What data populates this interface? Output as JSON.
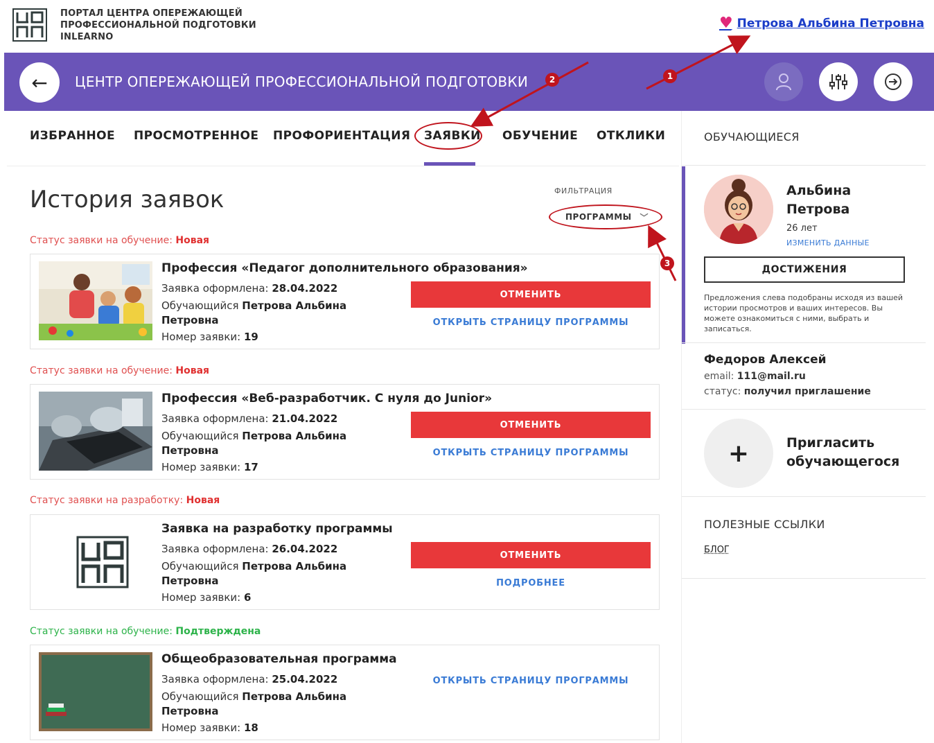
{
  "portal": {
    "name_line1": "ПОРТАЛ ЦЕНТРА ОПЕРЕЖАЮЩЕЙ",
    "name_line2": "ПРОФЕССИОНАЛЬНОЙ ПОДГОТОВКИ",
    "name_line3": "INLEARNO",
    "user_link": "Петрова Альбина Петровна"
  },
  "header": {
    "title": "ЦЕНТР ОПЕРЕЖАЮЩЕЙ ПРОФЕССИОНАЛЬНОЙ ПОДГОТОВКИ"
  },
  "tabs": [
    {
      "label": "ИЗБРАННОЕ"
    },
    {
      "label": "ПРОСМОТРЕННОЕ"
    },
    {
      "label": "ПРОФОРИЕНТАЦИЯ"
    },
    {
      "label": "ЗАЯВКИ",
      "active": true
    },
    {
      "label": "ОБУЧЕНИЕ"
    },
    {
      "label": "ОТКЛИКИ"
    }
  ],
  "main": {
    "title": "История заявок",
    "filter_label": "ФИЛЬТРАЦИЯ",
    "filter_value": "ПРОГРАММЫ"
  },
  "applications": [
    {
      "status_prefix": "Статус заявки на обучение:",
      "status_value": "Новая",
      "title": "Профессия «Педагог дополнительного образования»",
      "date_label": "Заявка оформлена:",
      "date": "28.04.2022",
      "student_label": "Обучающийся",
      "student_line1": "Петрова Альбина",
      "student_line2": "Петровна",
      "number_label": "Номер заявки:",
      "number": "19",
      "cancel_label": "ОТМЕНИТЬ",
      "link_label": "ОТКРЫТЬ СТРАНИЦУ ПРОГРАММЫ"
    },
    {
      "status_prefix": "Статус заявки на обучение:",
      "status_value": "Новая",
      "title": "Профессия «Веб-разработчик. С нуля до Junior»",
      "date_label": "Заявка оформлена:",
      "date": "21.04.2022",
      "student_label": "Обучающийся",
      "student_line1": "Петрова Альбина",
      "student_line2": "Петровна",
      "number_label": "Номер заявки:",
      "number": "17",
      "cancel_label": "ОТМЕНИТЬ",
      "link_label": "ОТКРЫТЬ СТРАНИЦУ ПРОГРАММЫ"
    },
    {
      "status_prefix": "Статус заявки на разработку:",
      "status_value": "Новая",
      "title": "Заявка на разработку программы",
      "date_label": "Заявка оформлена:",
      "date": "26.04.2022",
      "student_label": "Обучающийся",
      "student_line1": "Петрова Альбина",
      "student_line2": "Петровна",
      "number_label": "Номер заявки:",
      "number": "6",
      "cancel_label": "ОТМЕНИТЬ",
      "link_label": "ПОДРОБНЕЕ"
    },
    {
      "status_prefix": "Статус заявки на обучение:",
      "status_value": "Подтверждена",
      "title": "Общеобразовательная программа",
      "date_label": "Заявка оформлена:",
      "date": "25.04.2022",
      "student_label": "Обучающийся",
      "student_line1": "Петрова Альбина",
      "student_line2": "Петровна",
      "number_label": "Номер заявки:",
      "number": "18",
      "link_label": "ОТКРЫТЬ СТРАНИЦУ ПРОГРАММЫ"
    }
  ],
  "sidebar": {
    "students_heading": "ОБУЧАЮЩИЕСЯ",
    "profile_first": "Альбина",
    "profile_last": "Петрова",
    "profile_age": "26 лет",
    "edit_link": "ИЗМЕНИТЬ ДАННЫЕ",
    "achievements_label": "ДОСТИЖЕНИЯ",
    "note": "Предложения слева подобраны исходя из вашей истории просмотров и ваших интересов. Вы можете ознакомиться с ними, выбрать и записаться.",
    "student2_name": "Федоров Алексей",
    "student2_email_label": "email:",
    "student2_email": "111@mail.ru",
    "student2_status_label": "статус:",
    "student2_status": "получил приглашение",
    "invite_line1": "Пригласить",
    "invite_line2": "обучающегося",
    "links_heading": "ПОЛЕЗНЫЕ ССЫЛКИ",
    "blog_link": "БЛОГ"
  },
  "annotations": {
    "marker1": "1",
    "marker2": "2",
    "marker3": "3",
    "marker_heart": "2"
  },
  "colors": {
    "brand_purple": "#6a54b8",
    "cancel_red": "#e8383a",
    "link_blue": "#3a7bd5",
    "status_new": "#e03030",
    "status_confirmed": "#2db34a",
    "annotation_red": "#c0141d"
  }
}
